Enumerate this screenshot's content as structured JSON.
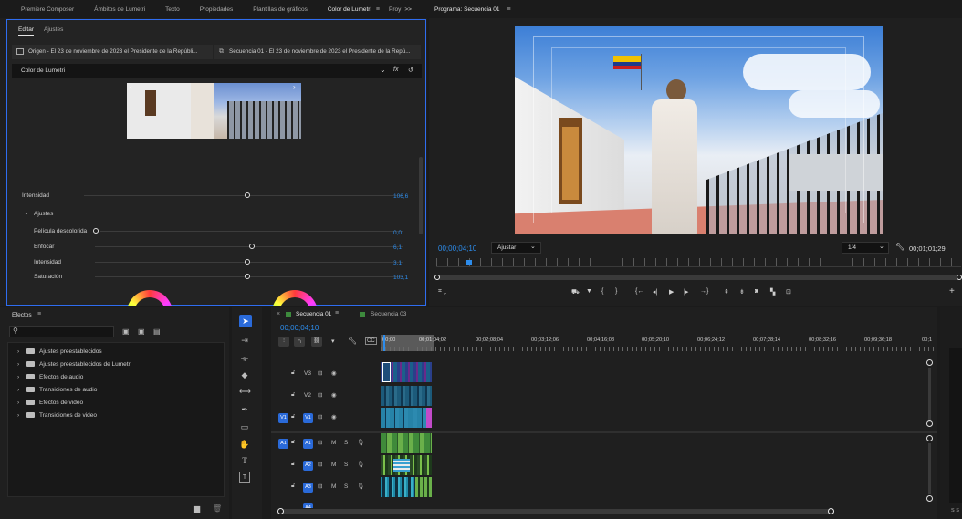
{
  "top_left_tabs": [
    "Premiere Composer",
    "Ámbitos de Lumetri",
    "Texto",
    "Propiedades",
    "Plantillas de gráficos",
    "Color de Lumetri",
    "Proy"
  ],
  "overflow_label": ">>",
  "lumetri": {
    "subtabs": [
      "Editar",
      "Ajustes"
    ],
    "source_label": "Origen - El 23 de noviembre de 2023 el Presidente de la Repúbli...",
    "sequence_label": "Secuencia 01 - El 23 de noviembre de 2023 el Presidente de la Repú...",
    "effect_label": "Color de Lumetri",
    "fx_label": "fx",
    "intensity_label": "Intensidad",
    "intensity_value": "106,6",
    "ajustes_label": "Ajustes",
    "adjust_rows": [
      {
        "label": "Película descolorida",
        "value": "0,0"
      },
      {
        "label": "Enfocar",
        "value": "6,1"
      },
      {
        "label": "Intensidad",
        "value": "3,1"
      },
      {
        "label": "Saturación",
        "value": "103,1"
      }
    ]
  },
  "program": {
    "title": "Programa: Secuencia 01",
    "timecode": "00;00;04;10",
    "fit_label": "Ajustar",
    "resolution": "1/4",
    "duration": "00;01;01;29"
  },
  "effects": {
    "title": "Efectos",
    "items": [
      "Ajustes preestablecidos",
      "Ajustes preestablecidos de Lumetri",
      "Efectos de audio",
      "Transiciones de audio",
      "Efectos de video",
      "Transiciones de video"
    ]
  },
  "timeline": {
    "tabs": [
      "Secuencia 01",
      "Secuencia 03"
    ],
    "timecode": "00;00;04;10",
    "ruler": [
      "00;00",
      "00;01;04;02",
      "00;02;08;04",
      "00;03;12;06",
      "00;04;16;08",
      "00;05;20;10",
      "00;06;24;12",
      "00;07;28;14",
      "00;08;32;16",
      "00;09;36;18",
      "00;1"
    ],
    "video_tracks": [
      "V3",
      "V2",
      "V1"
    ],
    "audio_tracks": [
      "A1",
      "A2",
      "A3",
      "A4"
    ],
    "source_v": "V1",
    "source_a": "A1",
    "mute_label": "M",
    "solo_label": "S"
  },
  "meter_label": "S S",
  "colors": {
    "accent": "#2d8ceb",
    "selection": "#2f6df0",
    "track_blue": "#2a6ad9"
  }
}
